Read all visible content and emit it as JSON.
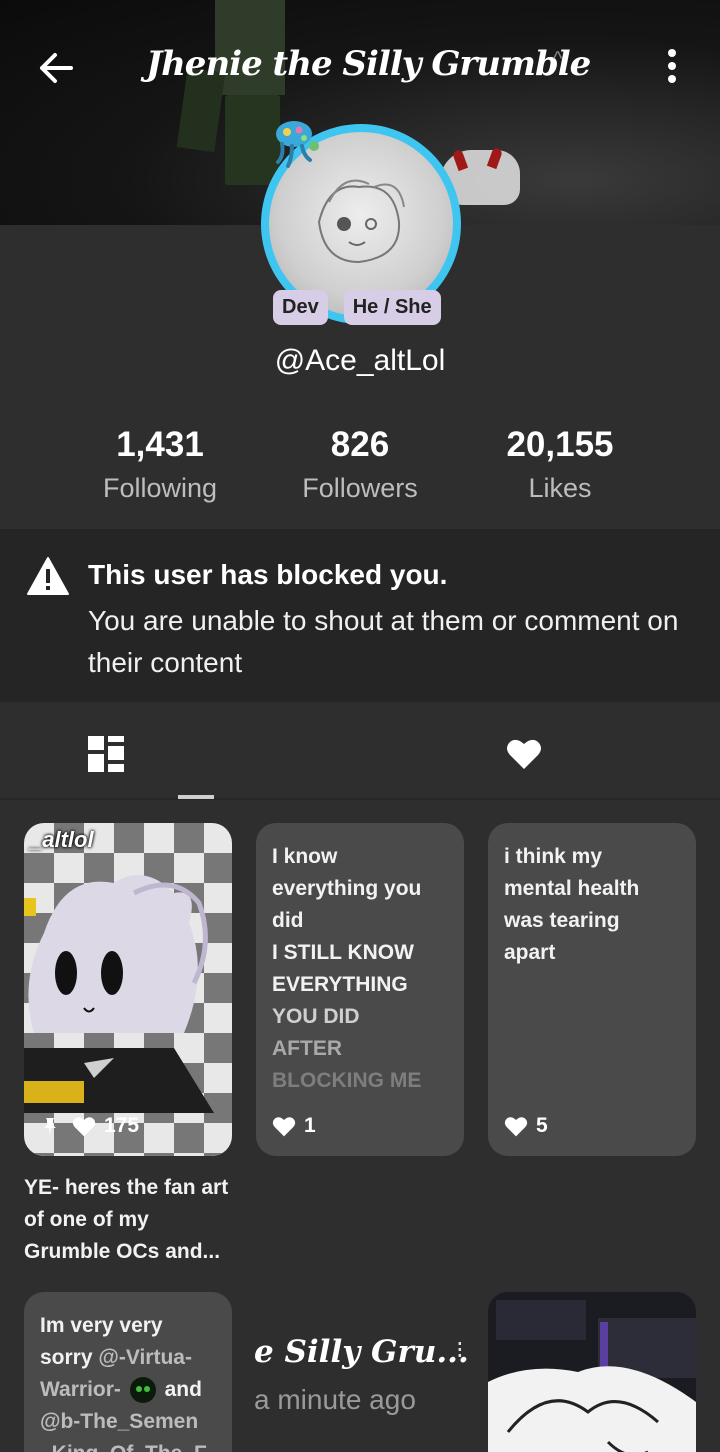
{
  "header": {
    "title": "Jhenie the Silly Grumble",
    "back_icon": "arrow-left-icon",
    "more_icon": "more-vertical-icon"
  },
  "profile": {
    "badges": [
      "Dev",
      "He / She"
    ],
    "username": "@Ace_altLol"
  },
  "stats": [
    {
      "value": "1,431",
      "label": "Following"
    },
    {
      "value": "826",
      "label": "Followers"
    },
    {
      "value": "20,155",
      "label": "Likes"
    }
  ],
  "blocked_notice": {
    "title": "This user has blocked you.",
    "text": "You are unable to shout at them or comment on their content"
  },
  "tabs": [
    {
      "icon": "grid-layout-icon",
      "active": true
    },
    {
      "icon": "heart-icon",
      "active": false
    }
  ],
  "posts": [
    {
      "type": "image",
      "watermark": "_altlol",
      "likes": "175",
      "pinned": true,
      "caption": "YE- heres the fan art of one of my Grumble OCs and..."
    },
    {
      "type": "text",
      "lines": [
        "I know",
        "everything you",
        "did",
        "I STILL KNOW",
        "EVERYTHING",
        "YOU DID",
        "AFTER",
        "BLOCKING ME"
      ],
      "likes": "1"
    },
    {
      "type": "text",
      "lines": [
        "i think my",
        "mental health",
        "was tearing",
        "apart"
      ],
      "likes": "5"
    },
    {
      "type": "text",
      "lines_parts": {
        "l1": "Im very very",
        "l2a": "sorry ",
        "l2b": "@-Virtua-",
        "l3a": "Warrior-",
        "l3b": " and",
        "l4": "@b-The_Semen",
        "l5": "_King_Of_The_F"
      }
    },
    {
      "type": "partial",
      "title": "e Silly Gru...",
      "time": "a minute ago"
    },
    {
      "type": "image-screenshot"
    }
  ],
  "colors": {
    "accent_ring": "#3ec6f0",
    "badge_bg": "#d8cde6",
    "card_bg": "#4a4a4a",
    "page_bg": "#2e2e2e"
  }
}
